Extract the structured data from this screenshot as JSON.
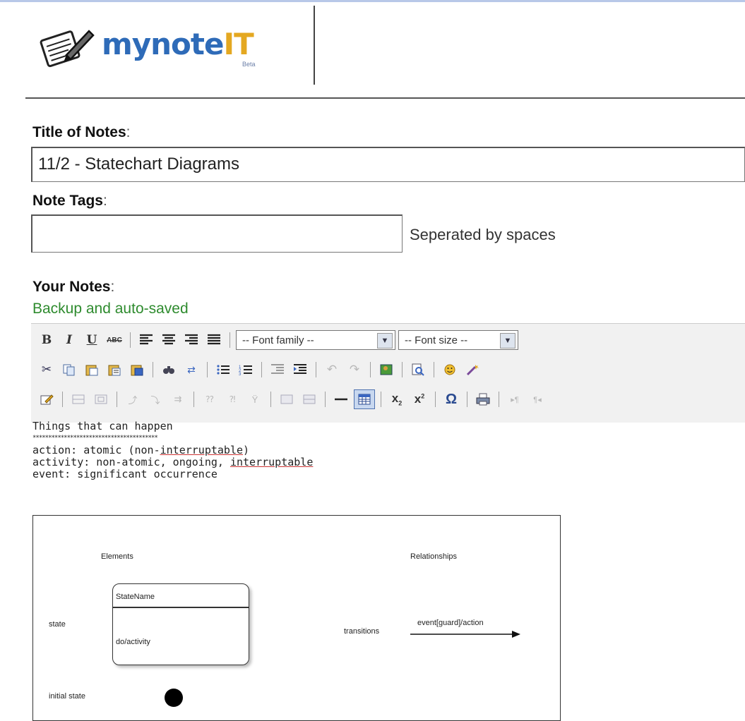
{
  "header": {
    "logo_text_main": "mynote",
    "logo_text_accent": "IT",
    "logo_beta": "Beta"
  },
  "form": {
    "title_label": "Title of Notes",
    "title_value": "11/2 - Statechart Diagrams",
    "tags_label": "Note Tags",
    "tags_value": "",
    "tags_hint": "Seperated by spaces",
    "notes_label": "Your Notes",
    "notes_status": "Backup and auto-saved",
    "colon": ":"
  },
  "toolbar": {
    "font_family": "-- Font family --",
    "font_size": "-- Font size --"
  },
  "editor": {
    "line1": "Things that can happen",
    "line2": "****************************************",
    "line3_a": "action: atomic (non-",
    "line3_b": "interruptable",
    "line3_c": ")",
    "line4_a": "activity: non-atomic, ongoing, ",
    "line4_b": "interruptable",
    "line5": "event: significant occurrence"
  },
  "diagram": {
    "elements_heading": "Elements",
    "relationships_heading": "Relationships",
    "state_label": "state",
    "state_name": "StateName",
    "state_activity": "do/activity",
    "transition_label": "transitions",
    "transition_text": "event[guard]/action",
    "initial_state_label": "initial state"
  },
  "colors": {
    "logo_blue": "#2e6bb8",
    "logo_orange": "#e4a821",
    "status_green": "#2e8b2e"
  }
}
